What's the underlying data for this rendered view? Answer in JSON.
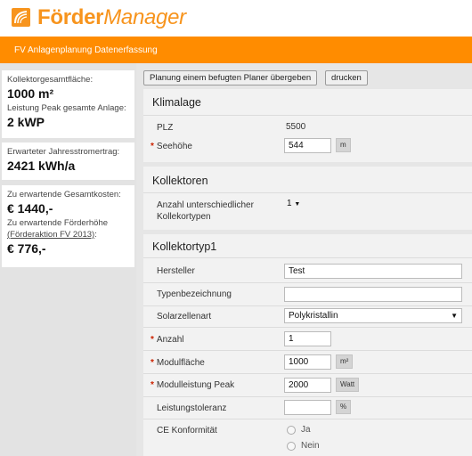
{
  "header": {
    "brand_bold": "Förder",
    "brand_italic": "Manager",
    "subtitle": "FV Anlagenplanung Datenerfassung"
  },
  "summary": {
    "area_label": "Kollektorgesamtfläche:",
    "area_value": "1000 m²",
    "peak_label": "Leistung Peak gesamte Anlage:",
    "peak_value": "2 kWP",
    "yield_label": "Erwarteter Jahresstromertrag:",
    "yield_value": "2421 kWh/a",
    "cost_label": "Zu erwartende Gesamtkosten:",
    "cost_value": "€ 1440,-",
    "funding_label": "Zu erwartende Förderhöhe",
    "funding_link": "(Förderaktion FV 2013)",
    "funding_colon": ":",
    "funding_value": "€ 776,-"
  },
  "toolbar": {
    "handover_label": "Planung einem befugten Planer übergeben",
    "print_label": "drucken"
  },
  "klimalage": {
    "title": "Klimalage",
    "plz_label": "PLZ",
    "plz_value": "5500",
    "seehoehe_label": "Seehöhe",
    "seehoehe_value": "544",
    "seehoehe_unit": "m"
  },
  "kollektoren": {
    "title": "Kollektoren",
    "count_label_1": "Anzahl unterschiedlicher",
    "count_label_2": "Kollekortypen",
    "count_value": "1"
  },
  "kollektortyp": {
    "title": "Kollektortyp1",
    "hersteller_label": "Hersteller",
    "hersteller_value": "Test",
    "typ_label": "Typenbezeichnung",
    "typ_value": "",
    "zellenart_label": "Solarzellenart",
    "zellenart_value": "Polykristallin",
    "anzahl_label": "Anzahl",
    "anzahl_value": "1",
    "flaeche_label": "Modulfläche",
    "flaeche_value": "1000",
    "flaeche_unit": "m²",
    "peak_label": "Modulleistung Peak",
    "peak_value": "2000",
    "peak_unit": "Watt",
    "toleranz_label": "Leistungstoleranz",
    "toleranz_value": "",
    "toleranz_unit": "%",
    "ce_label": "CE Konformität",
    "ce_yes": "Ja",
    "ce_no": "Nein"
  },
  "required_marker": "*",
  "colors": {
    "accent": "#ff8c00",
    "brand": "#f7941d"
  }
}
